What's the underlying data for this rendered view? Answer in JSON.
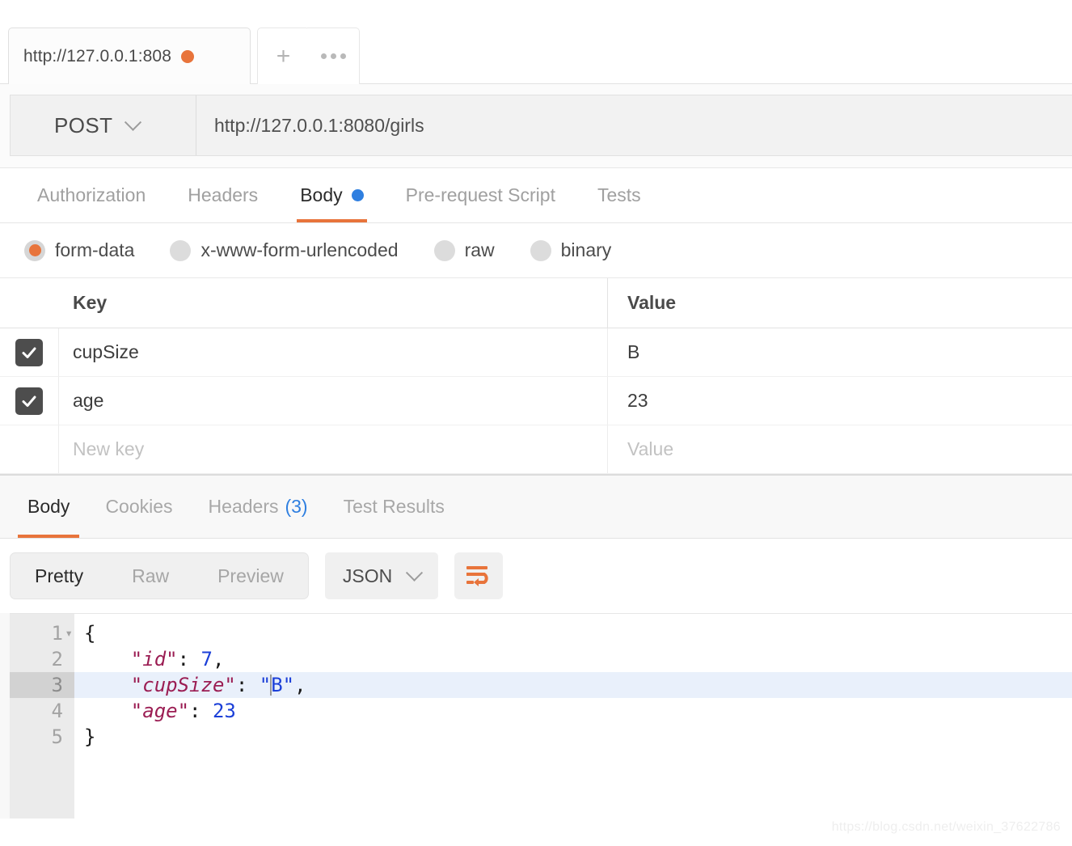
{
  "window": {
    "tab_title": "http://127.0.0.1:808",
    "unsaved_indicator": "unsaved-dot",
    "new_tab_icon": "plus-icon",
    "more_icon": "ellipsis-icon"
  },
  "request": {
    "method": "POST",
    "method_chevron_icon": "chevron-down-icon",
    "url": "http://127.0.0.1:8080/girls",
    "tabs": [
      {
        "label": "Authorization",
        "active": false,
        "dot": false
      },
      {
        "label": "Headers",
        "active": false,
        "dot": false
      },
      {
        "label": "Body",
        "active": true,
        "dot": true
      },
      {
        "label": "Pre-request Script",
        "active": false,
        "dot": false
      },
      {
        "label": "Tests",
        "active": false,
        "dot": false
      }
    ],
    "body_types": [
      {
        "label": "form-data",
        "selected": true
      },
      {
        "label": "x-www-form-urlencoded",
        "selected": false
      },
      {
        "label": "raw",
        "selected": false
      },
      {
        "label": "binary",
        "selected": false
      }
    ],
    "table": {
      "headers": {
        "key": "Key",
        "value": "Value"
      },
      "rows": [
        {
          "checked": true,
          "key": "cupSize",
          "value": "B"
        },
        {
          "checked": true,
          "key": "age",
          "value": "23"
        }
      ],
      "new_row": {
        "key_placeholder": "New key",
        "value_placeholder": "Value"
      }
    }
  },
  "response": {
    "tabs": [
      {
        "label": "Body",
        "count": "",
        "active": true
      },
      {
        "label": "Cookies",
        "count": "",
        "active": false
      },
      {
        "label": "Headers",
        "count": "(3)",
        "active": false
      },
      {
        "label": "Test Results",
        "count": "",
        "active": false
      }
    ],
    "view_modes": [
      {
        "label": "Pretty",
        "active": true
      },
      {
        "label": "Raw",
        "active": false
      },
      {
        "label": "Preview",
        "active": false
      }
    ],
    "format": "JSON",
    "format_chevron_icon": "chevron-down-icon",
    "wrap_icon": "word-wrap-icon",
    "editor": {
      "current_line": 3,
      "fold_marker": "▾",
      "lines": [
        {
          "n": "1",
          "fold": true,
          "tokens": [
            {
              "t": "{",
              "c": "punc"
            }
          ]
        },
        {
          "n": "2",
          "fold": false,
          "tokens": [
            {
              "t": "    \"id\"",
              "c": "k"
            },
            {
              "t": ": ",
              "c": "punc"
            },
            {
              "t": "7",
              "c": "num"
            },
            {
              "t": ",",
              "c": "punc"
            }
          ]
        },
        {
          "n": "3",
          "fold": false,
          "tokens": [
            {
              "t": "    \"cupSize\"",
              "c": "k"
            },
            {
              "t": ": ",
              "c": "punc"
            },
            {
              "t": "\"",
              "c": "str"
            },
            {
              "t": "CARET",
              "c": "caret"
            },
            {
              "t": "B\"",
              "c": "str"
            },
            {
              "t": ",",
              "c": "punc"
            }
          ]
        },
        {
          "n": "4",
          "fold": false,
          "tokens": [
            {
              "t": "    \"age\"",
              "c": "k"
            },
            {
              "t": ": ",
              "c": "punc"
            },
            {
              "t": "23",
              "c": "num"
            }
          ]
        },
        {
          "n": "5",
          "fold": false,
          "tokens": [
            {
              "t": "}",
              "c": "punc"
            }
          ]
        }
      ]
    }
  },
  "watermark": "https://blog.csdn.net/weixin_37622786",
  "colors": {
    "accent_orange": "#e8743b",
    "info_blue": "#2f7fe0",
    "json_key": "#9b1d53",
    "json_value": "#1b3fd8",
    "checkbox": "#4d4d4d"
  }
}
